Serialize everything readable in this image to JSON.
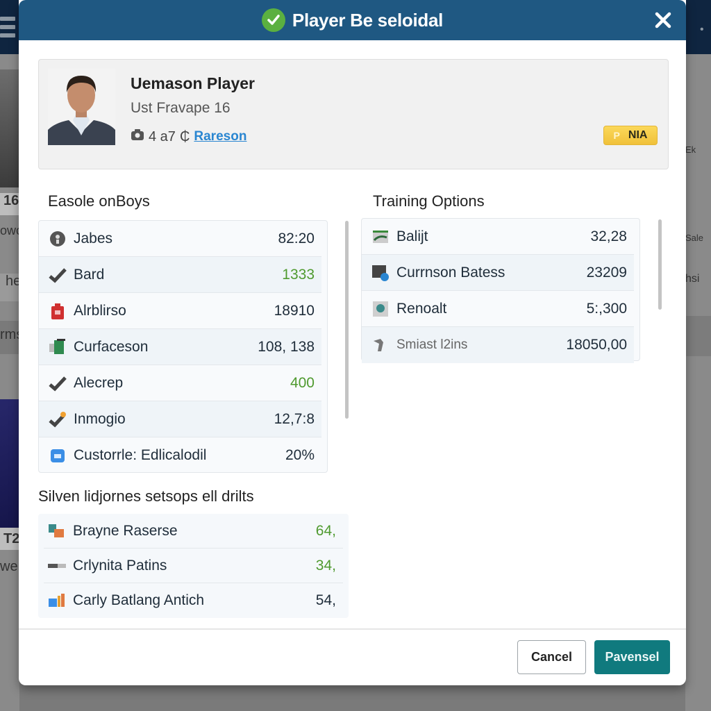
{
  "background": {
    "left_cells": [
      "16",
      "owc",
      "he",
      "rms",
      "T2",
      "we"
    ],
    "right_cells": [
      "Ek",
      "Sale",
      "hsi"
    ]
  },
  "modal": {
    "title": "Player Be seloidal",
    "close_label": "×"
  },
  "player": {
    "name": "Uemason Player",
    "subtitle": "Ust Fravape 16",
    "meta_count": "4 a7",
    "meta_link": "Rareson",
    "badge": "NIA"
  },
  "left_section": {
    "title": "Easole onBoys",
    "items": [
      {
        "icon": "info-circle-icon",
        "label": "Jabes",
        "value": "82:20",
        "highlight": false
      },
      {
        "icon": "check-icon",
        "label": "Bard",
        "value": "1333",
        "highlight": true
      },
      {
        "icon": "bag-icon",
        "label": "Alrblirso",
        "value": "18910",
        "highlight": false
      },
      {
        "icon": "card-icon",
        "label": "Curfaceson",
        "value": "108, 138",
        "highlight": false
      },
      {
        "icon": "check-icon",
        "label": "Alecrep",
        "value": "400",
        "highlight": true
      },
      {
        "icon": "check-star-icon",
        "label": "Inmogio",
        "value": "12,7:8",
        "highlight": false
      },
      {
        "icon": "id-card-icon",
        "label": "Custorrle: Edlicalodil",
        "value": "20%",
        "highlight": false
      }
    ]
  },
  "right_section": {
    "title": "Training Options",
    "items": [
      {
        "icon": "image-icon",
        "label": "Balijt",
        "value": "32,28"
      },
      {
        "icon": "monitor-icon",
        "label": "Currnson Batess",
        "value": "23209"
      },
      {
        "icon": "search-image-icon",
        "label": "Renoalt",
        "value": "5:,300"
      },
      {
        "icon": "tool-icon",
        "label": "Smiast l2ins",
        "value": "18050,00"
      }
    ]
  },
  "bottom_section": {
    "title": "Silven lidjornes setsops ell drilts",
    "items": [
      {
        "icon": "tiles-icon",
        "label": "Brayne Raserse",
        "value": "64,",
        "highlight": true
      },
      {
        "icon": "bar-icon",
        "label": "Crlynita Patins",
        "value": "34,",
        "highlight": true
      },
      {
        "icon": "chart-icon",
        "label": "Carly Batlang Antich",
        "value": "54,",
        "highlight": false
      }
    ]
  },
  "footer": {
    "cancel_label": "Cancel",
    "primary_label": "Pavensel"
  },
  "colors": {
    "header": "#1f5882",
    "primary_button": "#107a7e",
    "success": "#5bb040",
    "highlight_value": "#4f9a2f",
    "badge": "#f5cc45",
    "link": "#2a86d1"
  }
}
